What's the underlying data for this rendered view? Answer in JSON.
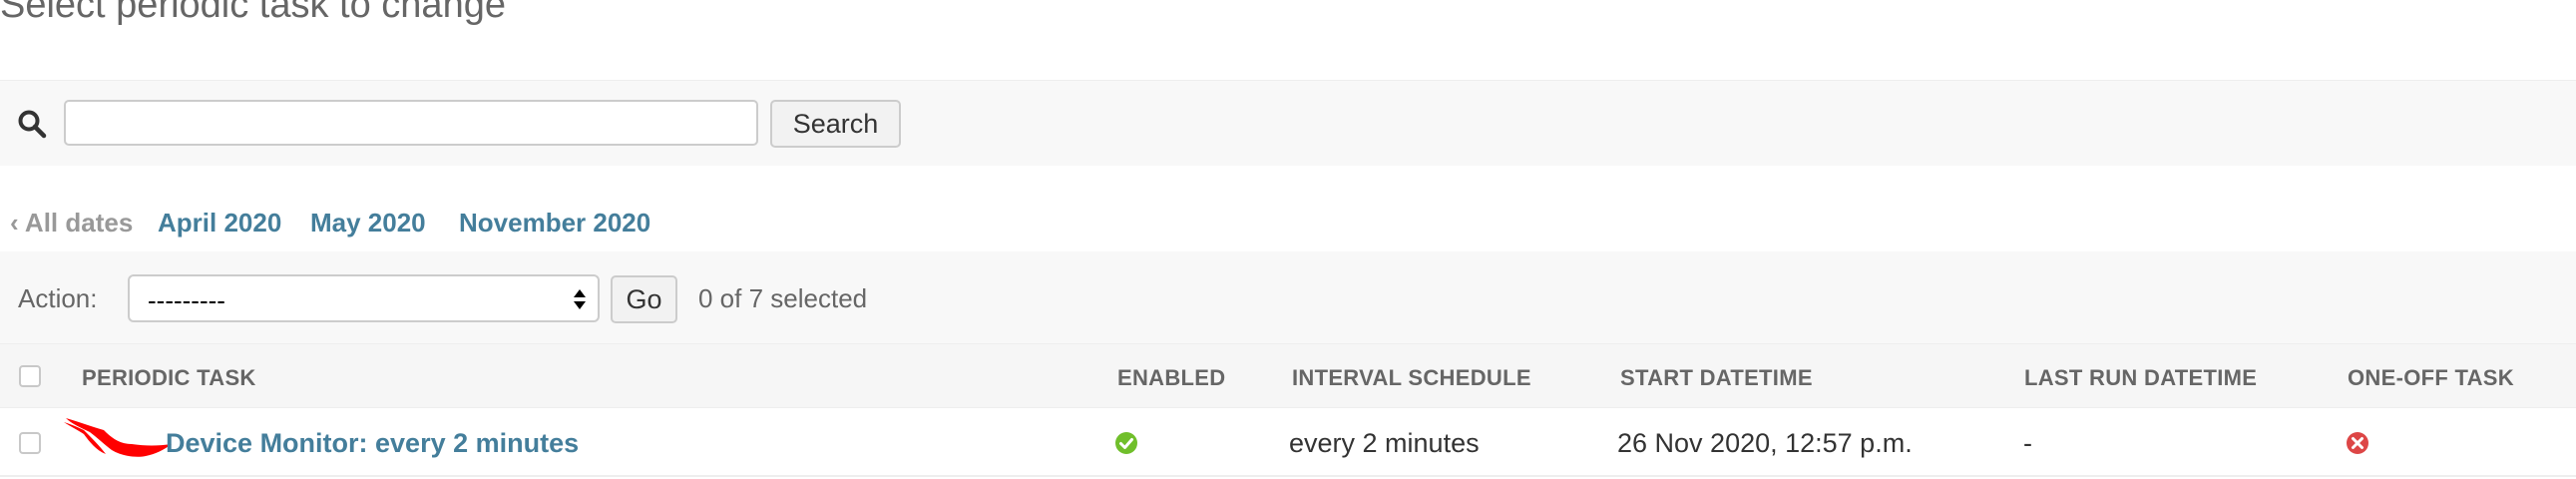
{
  "page": {
    "title": "Select periodic task to change"
  },
  "search": {
    "value": "",
    "button_label": "Search",
    "icon": "search-icon"
  },
  "date_hierarchy": {
    "all_label": "‹ All dates",
    "items": [
      "April 2020",
      "May 2020",
      "November 2020"
    ]
  },
  "actions": {
    "label": "Action:",
    "selected_value": "---------",
    "go_label": "Go",
    "selected_count": "0 of 7 selected"
  },
  "table": {
    "columns": [
      "PERIODIC TASK",
      "ENABLED",
      "INTERVAL SCHEDULE",
      "START DATETIME",
      "LAST RUN DATETIME",
      "ONE-OFF TASK"
    ],
    "rows": [
      {
        "periodic_task": "Device Monitor: every 2 minutes",
        "enabled": true,
        "interval_schedule": "every 2 minutes",
        "start_datetime": "26 Nov 2020, 12:57 p.m.",
        "last_run_datetime": "-",
        "one_off_task": false
      }
    ]
  },
  "colors": {
    "link": "#447e9b",
    "enabled_icon": "#70bf2b",
    "disabled_icon": "#dd4646",
    "redaction": "#ff0000"
  }
}
